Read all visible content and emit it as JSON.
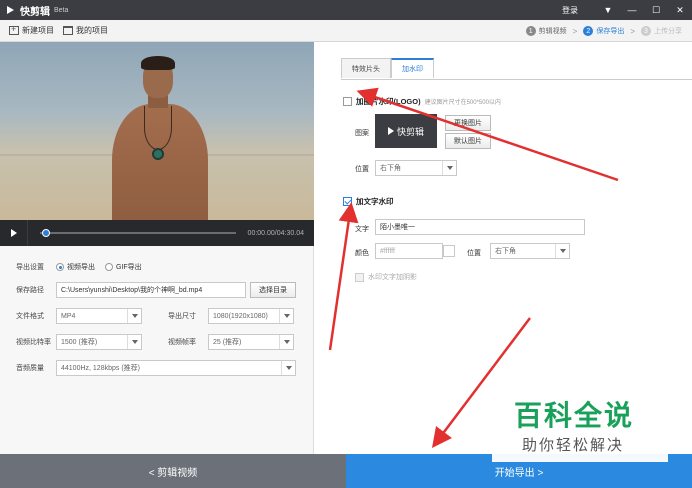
{
  "app": {
    "title": "快剪辑",
    "badge": "Beta",
    "login": "登录"
  },
  "window_controls": {
    "menu": "▼",
    "minimize": "—",
    "maximize": "☐",
    "close": "✕"
  },
  "toolbar": {
    "new_project": "新建项目",
    "my_projects": "我的项目"
  },
  "steps": [
    {
      "num": "1",
      "label": "剪辑视频"
    },
    {
      "num": "2",
      "label": "保存导出"
    },
    {
      "num": "3",
      "label": "上传分享"
    }
  ],
  "player": {
    "timecode": "00:00.00/04:30.04",
    "progress": 0.02
  },
  "export_settings": {
    "section_label": "导出设置",
    "mode_video": "视频导出",
    "mode_gif": "GIF导出",
    "save_path_label": "保存路径",
    "save_path_value": "C:\\Users\\yunshi\\Desktop\\我的个神啊_bd.mp4",
    "choose_dir": "选择目录",
    "format_label": "文件格式",
    "format_value": "MP4",
    "size_label": "导出尺寸",
    "size_value": "1080(1920x1080)",
    "bitrate_label": "视频比特率",
    "bitrate_value": "1500 (推荐)",
    "framerate_label": "视频帧率",
    "framerate_value": "25 (推荐)",
    "audio_label": "音频质量",
    "audio_value": "44100Hz, 128kbps (推荐)"
  },
  "right": {
    "tab_effects": "特效片头",
    "tab_watermark": "加水印",
    "image_wm_label": "加图片水印(LOGO)",
    "image_wm_hint": "建议图片尺寸在500*500以内",
    "icon_label": "图案",
    "preview_text": "快剪辑",
    "change_image": "更换图片",
    "default_image": "默认图片",
    "position_label": "位置",
    "position_value": "右下角",
    "text_wm_label": "加文字水印",
    "text_label": "文字",
    "text_value": "陌小墨唯一",
    "color_label": "颜色",
    "color_value": "#ffffff",
    "text_position_label": "位置",
    "text_position_value": "右下角",
    "shadow_label": "水印文字加阴影"
  },
  "bottom": {
    "back": "< 剪辑视频",
    "export": "开始导出 >"
  },
  "watermark": {
    "big": "百科全说",
    "small": "助你轻松解决"
  },
  "colors": {
    "accent": "#2b7ed9",
    "annotation": "#e2302f",
    "brand_green": "#19a05a"
  }
}
